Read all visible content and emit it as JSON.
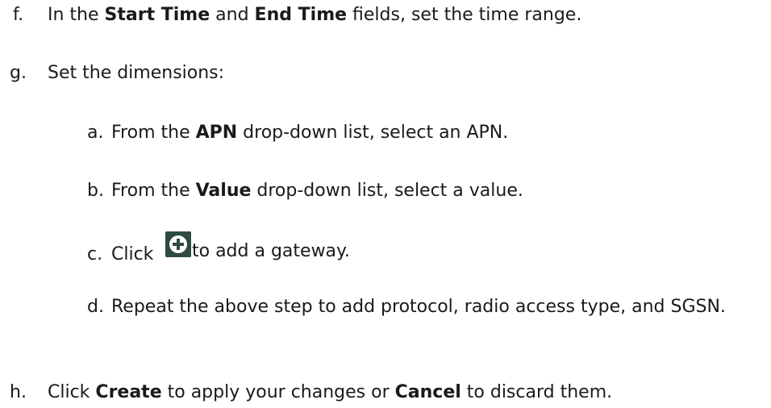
{
  "steps": {
    "f": {
      "marker": "f.",
      "t1": "In the ",
      "b1": "Start Time",
      "t2": " and ",
      "b2": "End Time",
      "t3": " fields, set the time range."
    },
    "g": {
      "marker": "g.",
      "text": "Set the dimensions:"
    },
    "h": {
      "marker": "h.",
      "t1": "Click ",
      "b1": "Create",
      "t2": " to apply your changes or ",
      "b2": "Cancel",
      "t3": " to discard them."
    }
  },
  "substeps": {
    "a": {
      "marker": "a.",
      "t1": "From the ",
      "b1": "APN",
      "t2": " drop-down list, select an APN."
    },
    "b": {
      "marker": "b.",
      "t1": "From the ",
      "b1": "Value",
      "t2": " drop-down list, select a value."
    },
    "c": {
      "marker": "c.",
      "t1": "Click",
      "icon": "add-circle-icon",
      "t2": "to add a gateway."
    },
    "d": {
      "marker": "d.",
      "text": "Repeat the above step to add protocol, radio access type, and SGSN."
    }
  },
  "colors": {
    "text": "#1a1a1a",
    "icon_background": "#2f4a44",
    "icon_symbol": "#ffffff"
  }
}
